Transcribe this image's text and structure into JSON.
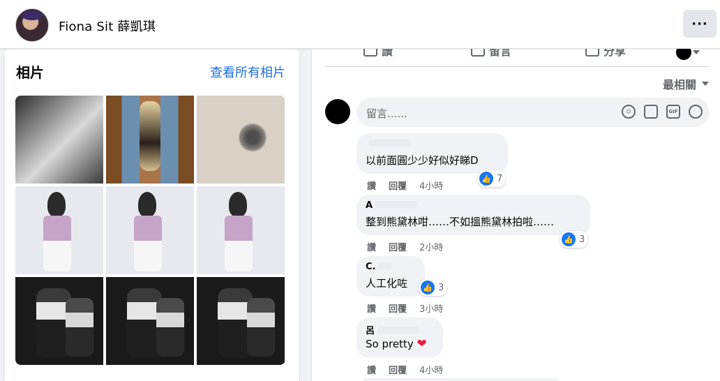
{
  "profile": {
    "name": "Fiona Sit 薛凱琪",
    "more_label": "···"
  },
  "photos": {
    "title": "相片",
    "view_all": "查看所有相片",
    "items": [
      "photo-1",
      "photo-2",
      "photo-3",
      "photo-4",
      "photo-5",
      "photo-6",
      "photo-7",
      "photo-8",
      "photo-9"
    ]
  },
  "post_actions": {
    "like": "讚",
    "comment": "留言",
    "share": "分享"
  },
  "sort_label": "最相關",
  "comment_input": {
    "placeholder": "留言......"
  },
  "comments": [
    {
      "author": "",
      "text": "以前面圓少少好似好睇D",
      "like_label": "讚",
      "reply_label": "回覆",
      "time": "4小時",
      "reactions": "7"
    },
    {
      "author": "A",
      "text": "整到熊黛林咁……不如搵熊黛林拍啦……",
      "like_label": "讚",
      "reply_label": "回覆",
      "time": "2小時",
      "reactions": "3"
    },
    {
      "author": "C.",
      "text": "人工化咗",
      "like_label": "讚",
      "reply_label": "回覆",
      "time": "3小時",
      "reactions": "3"
    },
    {
      "author": "呂",
      "text": "So pretty",
      "heart": "❤",
      "like_label": "讚",
      "reply_label": "回覆",
      "time": "4小時"
    }
  ],
  "colors": {
    "link": "#216fdb",
    "like_blue": "#1877f2",
    "heart": "#e41e3f"
  }
}
